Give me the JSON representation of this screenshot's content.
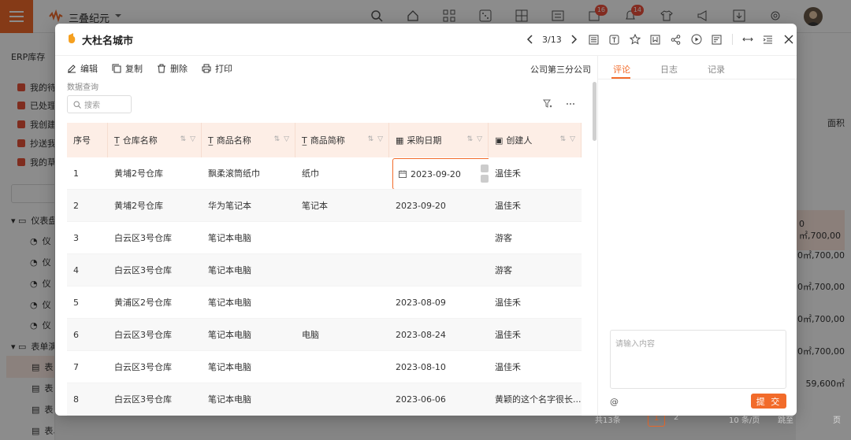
{
  "app": {
    "name": "三叠纪元",
    "badges": {
      "notifications": "16",
      "messages": "14"
    }
  },
  "sidebar": {
    "title": "ERP库存",
    "items": [
      {
        "label": "我的待办",
        "color": "#e8523a"
      },
      {
        "label": "已处理",
        "color": "#e8523a"
      },
      {
        "label": "我创建",
        "color": "#e8523a"
      },
      {
        "label": "抄送我",
        "color": "#e8523a"
      },
      {
        "label": "我的草稿",
        "color": "#e8523a"
      }
    ],
    "groups": [
      "仪表盘",
      "表单演示"
    ],
    "sub_items": [
      "仪",
      "仪",
      "仪",
      "仪",
      "仪"
    ],
    "form_items": [
      "表",
      "表",
      "表"
    ],
    "last_item": "表单演示数据（预算）"
  },
  "background": {
    "column_header": "面积",
    "values": [
      "0㎡,700,00",
      "0㎡,700,00",
      "0㎡,700,00",
      "0㎡,700,00",
      "0㎡,700,00",
      "59,600㎡"
    ],
    "footer": {
      "total": "共13条",
      "pages": [
        "1",
        "2"
      ],
      "page_size": "10 条/页",
      "goto": "跳至",
      "page_unit": "页"
    }
  },
  "modal": {
    "title": "大杜名城市",
    "pager": "3/13",
    "toolbar": {
      "edit": "编辑",
      "copy": "复制",
      "delete": "删除",
      "print": "打印"
    },
    "company": "公司第三分公司",
    "section": "数据查询",
    "search_placeholder": "搜索",
    "columns": [
      "序号",
      "仓库名称",
      "商品名称",
      "商品简称",
      "采购日期",
      "创建人"
    ],
    "rows": [
      {
        "no": "1",
        "warehouse": "黄埔2号仓库",
        "product": "飘柔滚筒纸巾",
        "short": "纸巾",
        "date": "2023-09-20",
        "creator": "温佳禾"
      },
      {
        "no": "2",
        "warehouse": "黄埔2号仓库",
        "product": "华为笔记本",
        "short": "笔记本",
        "date": "2023-09-20",
        "creator": "温佳禾"
      },
      {
        "no": "3",
        "warehouse": "白云区3号仓库",
        "product": "笔记本电脑",
        "short": "",
        "date": "",
        "creator": "游客"
      },
      {
        "no": "4",
        "warehouse": "白云区3号仓库",
        "product": "笔记本电脑",
        "short": "",
        "date": "",
        "creator": "游客"
      },
      {
        "no": "5",
        "warehouse": "黄浦区2号仓库",
        "product": "笔记本电脑",
        "short": "",
        "date": "2023-08-09",
        "creator": "温佳禾"
      },
      {
        "no": "6",
        "warehouse": "白云区3号仓库",
        "product": "笔记本电脑",
        "short": "电脑",
        "date": "2023-08-24",
        "creator": "温佳禾"
      },
      {
        "no": "7",
        "warehouse": "白云区3号仓库",
        "product": "笔记本电脑",
        "short": "",
        "date": "2023-08-10",
        "creator": "温佳禾"
      },
      {
        "no": "8",
        "warehouse": "白云区3号仓库",
        "product": "笔记本电脑",
        "short": "",
        "date": "2023-06-06",
        "creator": "黄颖的这个名字很长..."
      }
    ],
    "tabs": [
      "评论",
      "日志",
      "记录"
    ],
    "comment_placeholder": "请输入内容",
    "at": "@",
    "submit": "提 交"
  },
  "colors": {
    "accent": "#f26b2a",
    "header_bg": "#fdeee6"
  }
}
